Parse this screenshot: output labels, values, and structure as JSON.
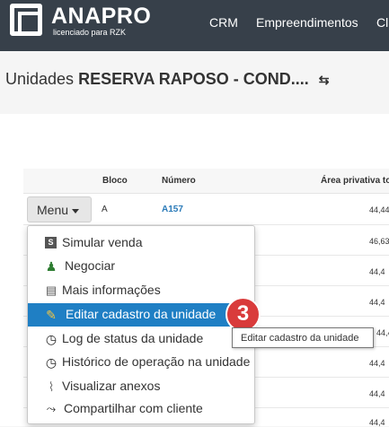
{
  "header": {
    "brand": "ANAPRO",
    "brand_sub": "licenciado para RZK",
    "nav": [
      "CRM",
      "Empreendimentos",
      "Cl"
    ]
  },
  "page": {
    "title_prefix": "Unidades",
    "title_strong": "RESERVA RAPOSO - COND...."
  },
  "table": {
    "headers": [
      "Bloco",
      "Número",
      "Área privativa tota"
    ],
    "first_row": {
      "bloco": "A",
      "numero": "A157",
      "area": "44,44"
    },
    "areas": [
      "44,44",
      "46,63",
      "44,4",
      "44,4",
      "44,4",
      "44,4",
      "44,4",
      "44,4",
      "44,4"
    ]
  },
  "menu": {
    "button_label": "Menu",
    "items": [
      {
        "label": "Simular venda",
        "icon": "simulate-icon"
      },
      {
        "label": "Negociar",
        "icon": "negotiate-icon"
      },
      {
        "label": "Mais informações",
        "icon": "info-doc-icon"
      },
      {
        "label": "Editar cadastro da unidade",
        "icon": "edit-pencil-icon",
        "active": true
      },
      {
        "label": "Log de status da unidade",
        "icon": "clock-icon"
      },
      {
        "label": "Histórico de operação na unidade",
        "icon": "clock-icon"
      },
      {
        "label": "Visualizar anexos",
        "icon": "paperclip-icon"
      },
      {
        "label": "Compartilhar com cliente",
        "icon": "share-icon"
      }
    ]
  },
  "annotation": {
    "step": "3"
  },
  "tooltip": {
    "text": "Editar cadastro da unidade"
  },
  "colors": {
    "topbar": "#37404a",
    "active_item": "#1f7fc4",
    "badge": "#d93b3b",
    "link": "#2a7ab8"
  }
}
